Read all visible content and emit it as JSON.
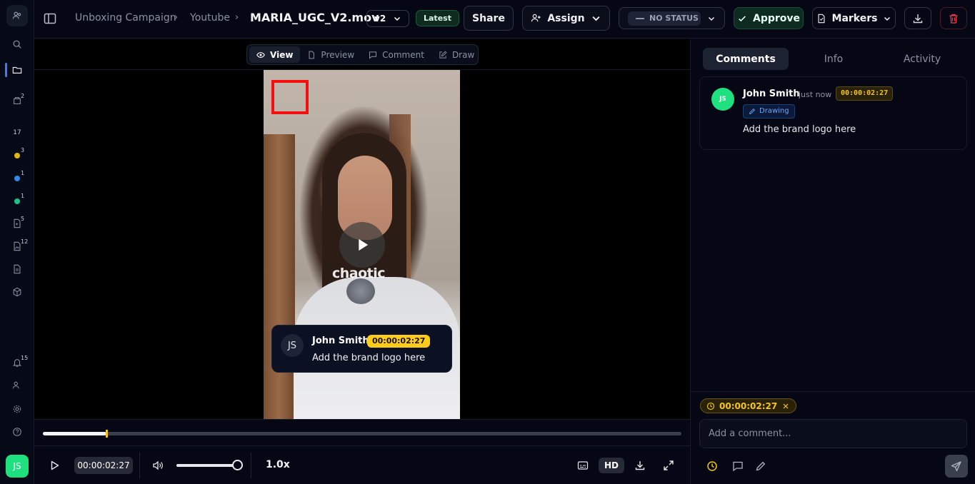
{
  "breadcrumb": {
    "project": "Unboxing Campaign",
    "folder": "Youtube"
  },
  "file": {
    "name": "MARIA_UGC_V2.mov",
    "version": "v2",
    "version_badge": "Latest"
  },
  "header_buttons": {
    "share": "Share",
    "assign": "Assign",
    "status": "NO STATUS",
    "approve": "Approve",
    "markers": "Markers"
  },
  "rail": {
    "counts": {
      "item_1": "2",
      "item_2": "17",
      "yellow": "3",
      "blue": "1",
      "green": "1",
      "item_6": "5",
      "item_7": "12",
      "notifications": "15"
    },
    "user_initials": "JS",
    "colors": {
      "yellow": "#e1b514",
      "blue": "#2f8be6",
      "green": "#1ec08a"
    }
  },
  "view_modes": [
    "View",
    "Preview",
    "Comment",
    "Draw"
  ],
  "video": {
    "watermark": "chaotic",
    "popup": {
      "initials": "JS",
      "author": "John Smith",
      "timestamp": "00:00:02:27",
      "text": "Add the brand logo here"
    }
  },
  "player": {
    "timecode": "00:00:02:27",
    "progress": 0.1,
    "volume": 1.0,
    "speed": "1.0x",
    "quality": "HD"
  },
  "panel": {
    "tabs": [
      "Comments",
      "Info",
      "Activity"
    ],
    "comment": {
      "initials": "JS",
      "author": "John Smith",
      "ago": "just now",
      "timestamp": "00:00:02:27",
      "tag": "Drawing",
      "text": "Add the brand logo here"
    },
    "composer": {
      "timestamp_chip": "00:00:02:27",
      "placeholder": "Add a comment..."
    }
  }
}
